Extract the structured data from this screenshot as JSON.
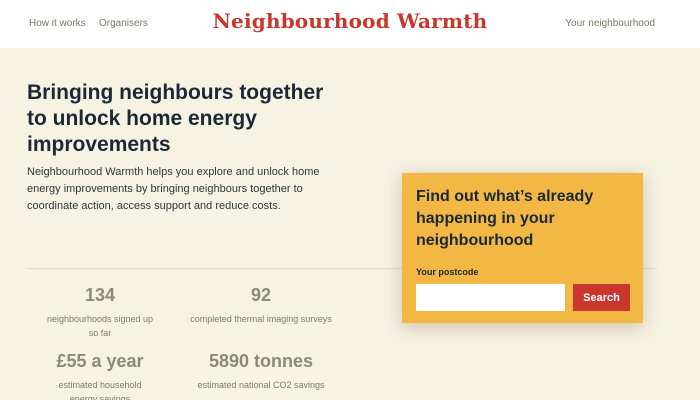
{
  "header": {
    "nav_left": [
      "How it works",
      "Organisers"
    ],
    "logo": "Neighbourhood Warmth",
    "nav_right": "Your neighbourhood"
  },
  "hero": {
    "title": "Bringing neighbours together to unlock home energy improvements",
    "description": "Neighbourhood Warmth helps you explore and unlock home energy improvements by bringing neighbours together to coordinate action, access support and reduce costs."
  },
  "stats": [
    {
      "value": "134",
      "label": "neighbourhoods signed up so far"
    },
    {
      "value": "92",
      "label": "completed thermal imaging surveys"
    },
    {
      "value": "£55 a year",
      "label": "estimated household energy savings"
    },
    {
      "value": "5890 tonnes",
      "label": "estimated national CO2 savings"
    }
  ],
  "search_card": {
    "title": "Find out what’s already happening in your neighbourhood",
    "postcode_label": "Your postcode",
    "postcode_value": "",
    "button_label": "Search"
  },
  "colors": {
    "brand_red": "#c9372c",
    "card_yellow": "#f2b843",
    "page_background": "#f7f3e3"
  }
}
